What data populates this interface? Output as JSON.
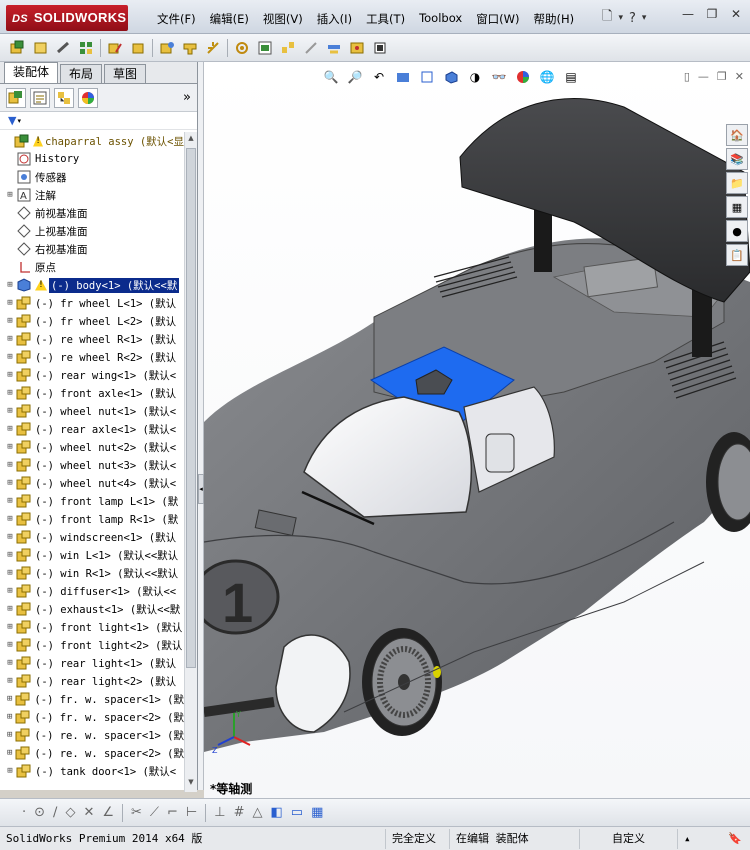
{
  "app": {
    "logo_prefix": "DS",
    "logo_text": "SOLIDWORKS"
  },
  "menu": [
    "文件(F)",
    "编辑(E)",
    "视图(V)",
    "插入(I)",
    "工具(T)",
    "Toolbox",
    "窗口(W)",
    "帮助(H)"
  ],
  "panel": {
    "tabs": [
      "装配体",
      "布局",
      "草图"
    ]
  },
  "tree": [
    {
      "label": "chaparral assy  (默认<显",
      "icon": "assembly-icon",
      "warn": true,
      "root": true
    },
    {
      "label": "History",
      "icon": "history-icon",
      "indent": true
    },
    {
      "label": "传感器",
      "icon": "sensor-icon",
      "indent": true
    },
    {
      "label": "注解",
      "icon": "annotation-icon",
      "exp": "+"
    },
    {
      "label": "前视基准面",
      "icon": "plane-icon",
      "indent": true
    },
    {
      "label": "上视基准面",
      "icon": "plane-icon",
      "indent": true
    },
    {
      "label": "右视基准面",
      "icon": "plane-icon",
      "indent": true
    },
    {
      "label": "原点",
      "icon": "origin-icon",
      "indent": true
    },
    {
      "label": "(-) body<1> (默认<<默",
      "icon": "part-icon",
      "warn": true,
      "selected": true,
      "exp": "+"
    },
    {
      "label": "(-) fr wheel L<1> (默认",
      "icon": "subassembly-icon",
      "exp": "+"
    },
    {
      "label": "(-) fr wheel L<2> (默认",
      "icon": "subassembly-icon",
      "exp": "+"
    },
    {
      "label": "(-) re wheel R<1> (默认",
      "icon": "subassembly-icon",
      "exp": "+"
    },
    {
      "label": "(-) re wheel R<2> (默认",
      "icon": "subassembly-icon",
      "exp": "+"
    },
    {
      "label": "(-) rear wing<1> (默认<",
      "icon": "subassembly-icon",
      "exp": "+"
    },
    {
      "label": "(-) front axle<1> (默认",
      "icon": "subassembly-icon",
      "exp": "+"
    },
    {
      "label": "(-) wheel nut<1> (默认<",
      "icon": "subassembly-icon",
      "exp": "+"
    },
    {
      "label": "(-) rear axle<1> (默认<",
      "icon": "subassembly-icon",
      "exp": "+"
    },
    {
      "label": "(-) wheel nut<2> (默认<",
      "icon": "subassembly-icon",
      "exp": "+"
    },
    {
      "label": "(-) wheel nut<3> (默认<",
      "icon": "subassembly-icon",
      "exp": "+"
    },
    {
      "label": "(-) wheel nut<4> (默认<",
      "icon": "subassembly-icon",
      "exp": "+"
    },
    {
      "label": "(-) front lamp L<1> (默",
      "icon": "subassembly-icon",
      "exp": "+"
    },
    {
      "label": "(-) front lamp R<1> (默",
      "icon": "subassembly-icon",
      "exp": "+"
    },
    {
      "label": "(-) windscreen<1> (默认",
      "icon": "subassembly-icon",
      "exp": "+"
    },
    {
      "label": "(-) win L<1> (默认<<默认",
      "icon": "subassembly-icon",
      "exp": "+"
    },
    {
      "label": "(-) win R<1> (默认<<默认",
      "icon": "subassembly-icon",
      "exp": "+"
    },
    {
      "label": "(-) diffuser<1> (默认<<",
      "icon": "subassembly-icon",
      "exp": "+"
    },
    {
      "label": "(-) exhaust<1> (默认<<默",
      "icon": "subassembly-icon",
      "exp": "+"
    },
    {
      "label": "(-) front light<1> (默认",
      "icon": "subassembly-icon",
      "exp": "+"
    },
    {
      "label": "(-) front light<2> (默认",
      "icon": "subassembly-icon",
      "exp": "+"
    },
    {
      "label": "(-) rear light<1> (默认",
      "icon": "subassembly-icon",
      "exp": "+"
    },
    {
      "label": "(-) rear light<2> (默认",
      "icon": "subassembly-icon",
      "exp": "+"
    },
    {
      "label": "(-) fr. w. spacer<1> (默",
      "icon": "subassembly-icon",
      "exp": "+"
    },
    {
      "label": "(-) fr. w. spacer<2> (默",
      "icon": "subassembly-icon",
      "exp": "+"
    },
    {
      "label": "(-) re. w. spacer<1> (默",
      "icon": "subassembly-icon",
      "exp": "+"
    },
    {
      "label": "(-) re. w. spacer<2> (默",
      "icon": "subassembly-icon",
      "exp": "+"
    },
    {
      "label": "(-) tank door<1> (默认<",
      "icon": "subassembly-icon",
      "exp": "+"
    }
  ],
  "viewport": {
    "view_label": "*等轴测"
  },
  "status": {
    "product": "SolidWorks Premium 2014 x64 版",
    "definition": "完全定义",
    "mode": "在编辑 装配体",
    "units": "自定义"
  },
  "colors": {
    "logo_red": "#c81f2a",
    "selection_blue": "#1e6bf0",
    "tree_selected": "#0b2b8c",
    "car_body": "#6e7074"
  }
}
